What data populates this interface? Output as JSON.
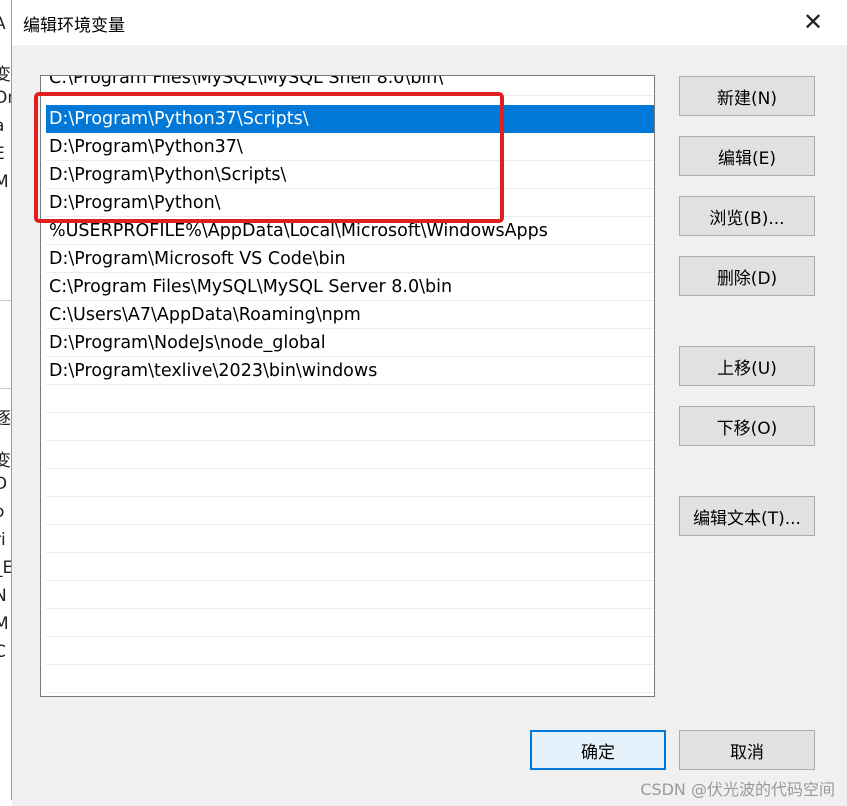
{
  "dialog": {
    "title": "编辑环境变量",
    "close_glyph": "✕"
  },
  "paths": [
    "C:\\Program Files\\MySQL\\MySQL Shell 8.0\\bin\\",
    "D:\\Program\\Python37\\Scripts\\",
    "D:\\Program\\Python37\\",
    "D:\\Program\\Python\\Scripts\\",
    "D:\\Program\\Python\\",
    "%USERPROFILE%\\AppData\\Local\\Microsoft\\WindowsApps",
    "D:\\Program\\Microsoft VS Code\\bin",
    "C:\\Program Files\\MySQL\\MySQL Server 8.0\\bin",
    "C:\\Users\\A7\\AppData\\Roaming\\npm",
    "D:\\Program\\NodeJs\\node_global",
    "D:\\Program\\texlive\\2023\\bin\\windows"
  ],
  "selected_index": 1,
  "buttons": {
    "new": "新建(N)",
    "edit": "编辑(E)",
    "browse": "浏览(B)...",
    "delete": "删除(D)",
    "move_up": "上移(U)",
    "move_down": "下移(O)",
    "edit_text": "编辑文本(T)...",
    "ok": "确定",
    "cancel": "取消"
  },
  "annotation_color": "#e02020",
  "selection_color": "#0078d7",
  "watermark": "CSDN @伏光波的代码空间"
}
